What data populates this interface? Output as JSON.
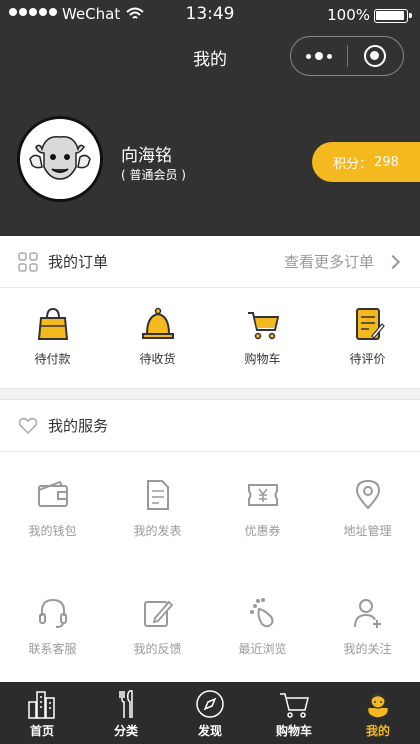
{
  "status_bar": {
    "carrier": "WeChat",
    "time": "13:49",
    "battery": "100%"
  },
  "nav": {
    "title": "我的"
  },
  "profile": {
    "name": "向海铭",
    "level": "( 普通会员 )",
    "points_label": "积分：",
    "points_value": "298"
  },
  "orders": {
    "title": "我的订单",
    "more": "查看更多订单",
    "items": [
      {
        "label": "待付款",
        "icon": "shopping-bag-icon"
      },
      {
        "label": "待收货",
        "icon": "bell-icon"
      },
      {
        "label": "购物车",
        "icon": "cart-icon"
      },
      {
        "label": "待评价",
        "icon": "review-note-icon"
      }
    ]
  },
  "services": {
    "title": "我的服务",
    "items": [
      {
        "label": "我的钱包",
        "icon": "wallet-icon"
      },
      {
        "label": "我的发表",
        "icon": "document-icon"
      },
      {
        "label": "优惠券",
        "icon": "coupon-icon"
      },
      {
        "label": "地址管理",
        "icon": "location-icon"
      },
      {
        "label": "联系客服",
        "icon": "headset-icon"
      },
      {
        "label": "我的反馈",
        "icon": "feedback-edit-icon"
      },
      {
        "label": "最近浏览",
        "icon": "footprint-icon"
      },
      {
        "label": "我的关注",
        "icon": "user-add-icon"
      }
    ]
  },
  "tabbar": {
    "items": [
      {
        "label": "首页",
        "icon": "buildings-icon"
      },
      {
        "label": "分类",
        "icon": "fork-knife-icon"
      },
      {
        "label": "发现",
        "icon": "compass-icon"
      },
      {
        "label": "购物车",
        "icon": "cart-icon"
      },
      {
        "label": "我的",
        "icon": "user-profile-icon",
        "active": true
      }
    ]
  },
  "colors": {
    "header_bg": "#323232",
    "accent": "#f4b91e",
    "tabbar_bg": "#2c2c2c"
  }
}
